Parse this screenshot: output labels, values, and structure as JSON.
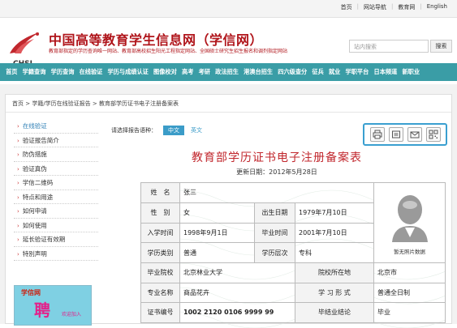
{
  "top_links": [
    "首页",
    "网站导航",
    "教育网",
    "English"
  ],
  "logo": {
    "text": "CHSI"
  },
  "site": {
    "title": "中国高等教育学生信息网（学信网）",
    "desc": "教育部指定的学历查询唯一网站、教育部高校招生阳光工程指定网站、全国硕士研究生招生报名和调剂指定网站"
  },
  "search": {
    "placeholder": "站内搜索",
    "button": "搜索"
  },
  "nav": [
    "首页",
    "学籍查询",
    "学历查询",
    "在线验证",
    "学历与成绩认证",
    "图像校对",
    "高考",
    "考研",
    "政法招生",
    "港澳台招生",
    "四六级查分",
    "征兵",
    "就业",
    "学职平台",
    "日本频道",
    "新职业"
  ],
  "breadcrumb": "首页 > 学籍/学历在线验证报告 > 教育部学历证书电子注册备案表",
  "sidebar": {
    "items": [
      "在线验证",
      "验证报告简介",
      "防伪措施",
      "验证真伪",
      "学信二维码",
      "特点和用途",
      "如何申请",
      "如何使用",
      "延长验证有效期",
      "特別声明"
    ],
    "ad_logo": "学信网",
    "ad_big": "聘",
    "ad_small": "欢迎加入"
  },
  "lang": {
    "label": "请选择报告语种：",
    "cn": "中文",
    "en": "英文"
  },
  "tools": [
    "print-icon",
    "print-alt-icon",
    "mail-icon",
    "qrcode-icon"
  ],
  "record": {
    "title": "教育部学历证书电子注册备案表",
    "date": "更新日期：2012年5月28日",
    "name_label": "姓　名",
    "name": "张三",
    "gender_label": "性　别",
    "gender": "女",
    "birth_label": "出生日期",
    "birth": "1979年7月10日",
    "enroll_label": "入学时间",
    "enroll": "1998年9月1日",
    "grad_label": "毕业时间",
    "grad": "2001年7月10日",
    "type_label": "学历类别",
    "type": "普通",
    "level_label": "学历层次",
    "level": "专科",
    "school_label": "毕业院校",
    "school": "北京林业大学",
    "loc_label": "院校所在地",
    "loc": "北京市",
    "major_label": "专业名称",
    "major": "商品花卉",
    "form_label": "学 习 形 式",
    "form": "普通全日制",
    "cert_label": "证书编号",
    "cert": "1002 2120 0106 9999 99",
    "concl_label": "毕结业结论",
    "concl": "毕业",
    "photo_caption": "暂无照片数据"
  }
}
